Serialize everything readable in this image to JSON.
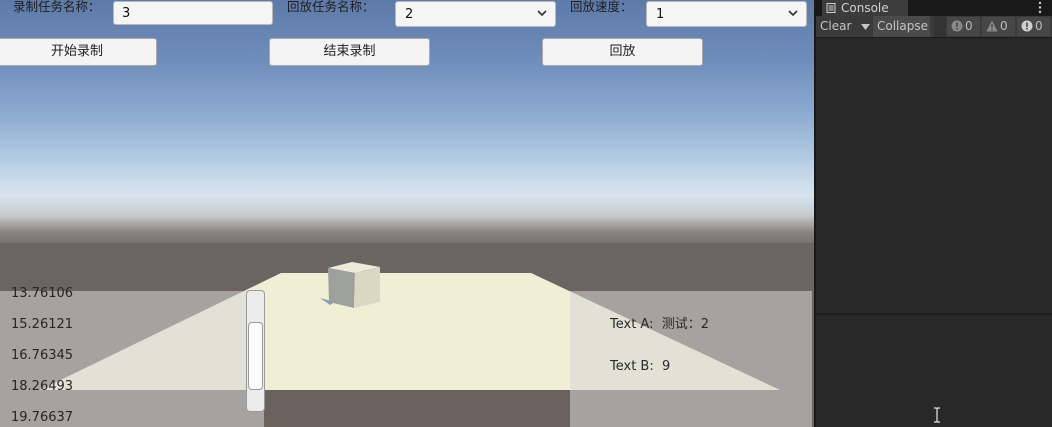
{
  "record_task": {
    "label": "录制任务名称：",
    "value": "3"
  },
  "replay_task": {
    "label": "回放任务名称：",
    "selected": "2"
  },
  "replay_speed": {
    "label": "回放速度：",
    "selected": "1"
  },
  "buttons": {
    "start_record": "开始录制",
    "stop_record": "结束录制",
    "replay": "回放"
  },
  "number_list": [
    "13.76106",
    "15.26121",
    "16.76345",
    "18.26493",
    "19.76637"
  ],
  "scroll": {
    "position_fraction": 0.6
  },
  "text_a": {
    "label": "Text A:",
    "value": "测试：2"
  },
  "text_b": {
    "label": "Text B:",
    "value": "9"
  },
  "console": {
    "tab_title": "Console",
    "clear": "Clear",
    "collapse": "Collapse",
    "error_count": "0",
    "warning_count": "0",
    "info_count": "0"
  },
  "colors": {
    "sky_top": "#5e7aa8",
    "horizon": "#d7e4ee",
    "ground": "#6a6360",
    "plane": "#f0efd6",
    "console_bg": "#282828"
  }
}
